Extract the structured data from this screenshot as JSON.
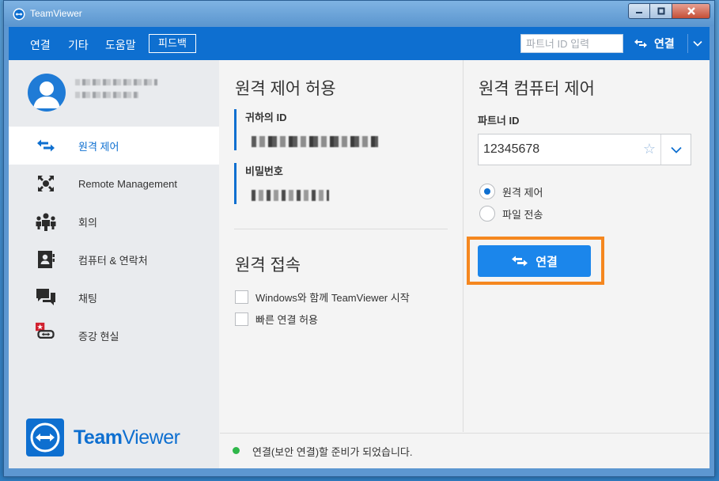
{
  "window": {
    "title": "TeamViewer"
  },
  "menu": {
    "items": [
      "연결",
      "기타",
      "도움말"
    ],
    "feedback": "피드백",
    "partner_placeholder": "파트너 ID 입력",
    "connect_label": "연결"
  },
  "sidebar": {
    "items": [
      {
        "label": "원격 제어",
        "icon": "arrows-icon",
        "active": true
      },
      {
        "label": "Remote Management",
        "icon": "remote-management-icon",
        "active": false
      },
      {
        "label": "회의",
        "icon": "meeting-icon",
        "active": false
      },
      {
        "label": "컴퓨터 & 연락처",
        "icon": "contacts-icon",
        "active": false
      },
      {
        "label": "채팅",
        "icon": "chat-icon",
        "active": false
      },
      {
        "label": "증강 현실",
        "icon": "augmented-reality-icon",
        "active": false
      }
    ],
    "logo_text_bold": "Team",
    "logo_text_light": "Viewer"
  },
  "allow_remote": {
    "title": "원격 제어 허용",
    "your_id_label": "귀하의 ID",
    "password_label": "비밀번호"
  },
  "unattended": {
    "title": "원격 접속",
    "options": [
      {
        "label": "Windows와 함께 TeamViewer 시작",
        "checked": false
      },
      {
        "label": "빠른 연결 허용",
        "checked": false
      }
    ]
  },
  "control_remote": {
    "title": "원격 컴퓨터 제어",
    "partner_id_label": "파트너 ID",
    "partner_id_value": "12345678",
    "modes": [
      {
        "label": "원격 제어",
        "selected": true
      },
      {
        "label": "파일 전송",
        "selected": false
      }
    ],
    "connect_label": "연결"
  },
  "status": {
    "text": "연결(보안 연결)할 준비가 되었습니다.",
    "color": "#2fb74a"
  },
  "colors": {
    "accent": "#0e6fd0",
    "highlight": "#f5871f"
  }
}
